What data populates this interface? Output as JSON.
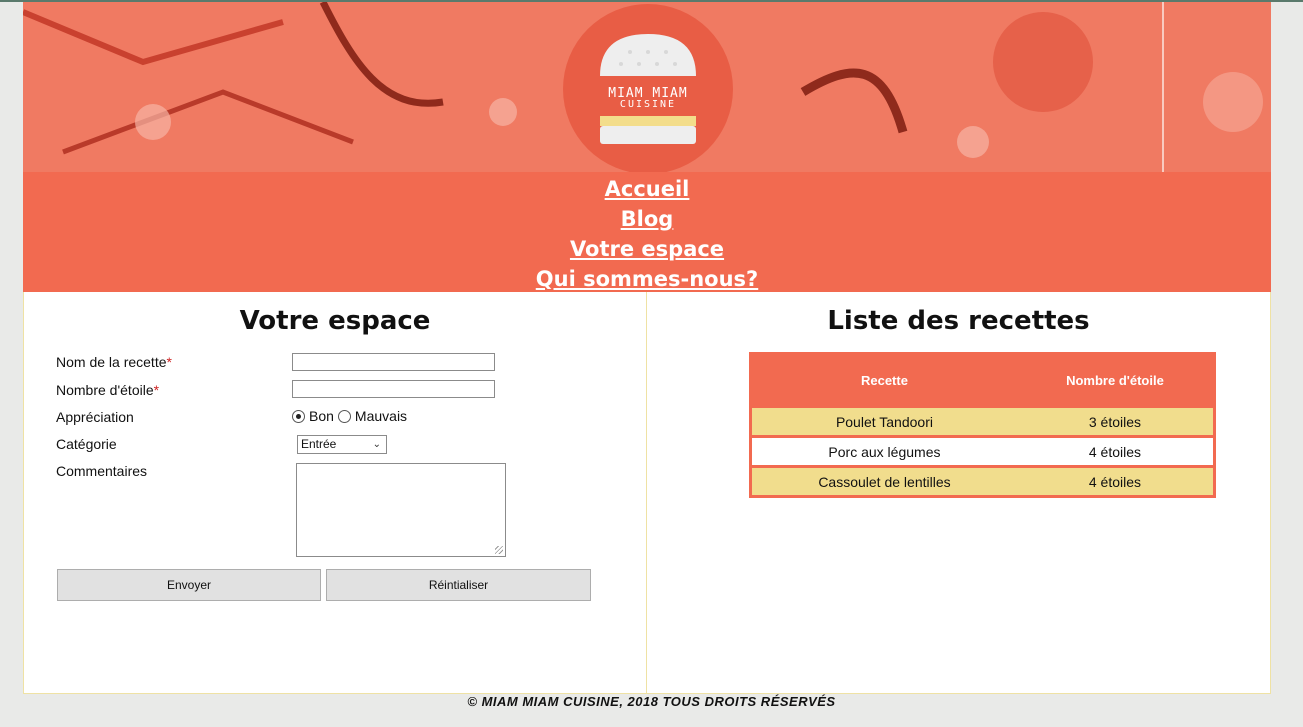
{
  "brand": {
    "line1": "MIAM MIAM",
    "line2": "CUISINE"
  },
  "nav": {
    "items": [
      {
        "label": "Accueil"
      },
      {
        "label": "Blog"
      },
      {
        "label": "Votre espace"
      },
      {
        "label": "Qui sommes-nous?"
      }
    ]
  },
  "form": {
    "title": "Votre espace",
    "recipe_name_label": "Nom de la recette",
    "stars_label": "Nombre d'étoile",
    "required_mark": "*",
    "appreciation_label": "Appréciation",
    "appreciation_options": [
      "Bon",
      "Mauvais"
    ],
    "appreciation_selected": "Bon",
    "category_label": "Catégorie",
    "category_selected": "Entrée",
    "comments_label": "Commentaires",
    "submit_label": "Envoyer",
    "reset_label": "Réintialiser"
  },
  "list": {
    "title": "Liste des recettes",
    "headers": [
      "Recette",
      "Nombre d'étoile"
    ],
    "rows": [
      [
        "Poulet Tandoori",
        "3 étoiles"
      ],
      [
        "Porc aux légumes",
        "4 étoiles"
      ],
      [
        "Cassoulet de lentilles",
        "4 étoiles"
      ]
    ]
  },
  "footer": {
    "text": "© MIAM MIAM CUISINE, 2018 TOUS DROITS RÉSERVÉS"
  },
  "colors": {
    "accent": "#f26a50",
    "row_highlight": "#f1dd8d",
    "border": "#efe2a4"
  }
}
